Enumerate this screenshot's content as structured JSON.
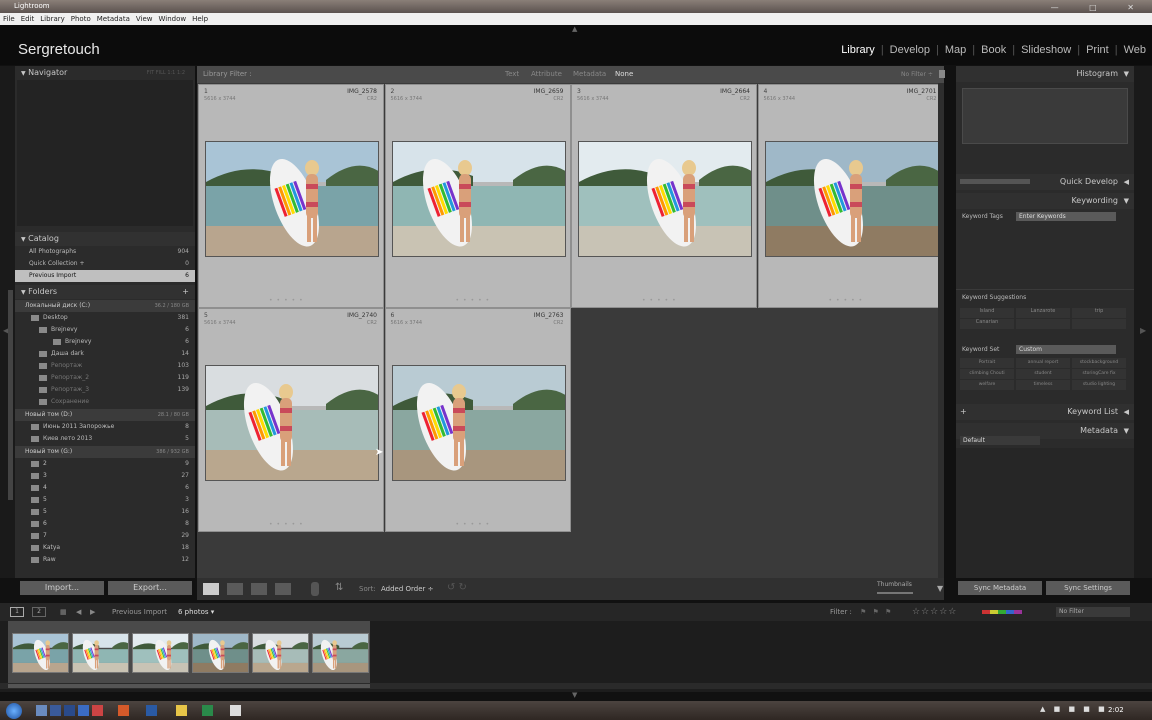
{
  "window": {
    "title": "Lightroom",
    "controls": "— □ ✕"
  },
  "menubar": [
    "File",
    "Edit",
    "Library",
    "Photo",
    "Metadata",
    "View",
    "Window",
    "Help"
  ],
  "header": {
    "identity": "Sergretouch",
    "modules": [
      "Library",
      "Develop",
      "Map",
      "Book",
      "Slideshow",
      "Print",
      "Web"
    ],
    "active_module": "Library"
  },
  "left_panel": {
    "navigator": {
      "title": "Navigator",
      "zoom": [
        "FIT",
        "FILL",
        "1:1",
        "1:2"
      ]
    },
    "catalog": {
      "title": "Catalog",
      "items": [
        {
          "label": "All Photographs",
          "count": "904"
        },
        {
          "label": "Quick Collection +",
          "count": "0"
        },
        {
          "label": "Previous Import",
          "count": "6"
        }
      ]
    },
    "folders": {
      "title": "Folders",
      "add": "+",
      "volumes": [
        {
          "name": "Локальный диск (C:)",
          "space": "36.2 / 180 GB",
          "items": [
            {
              "label": "Desktop",
              "count": "381"
            },
            {
              "label": "Brejnevy",
              "count": "6"
            },
            {
              "label": "Brejnevy",
              "count": "6"
            },
            {
              "label": "Даша dark",
              "count": "14"
            },
            {
              "label": "Репортаж",
              "count": "103"
            },
            {
              "label": "Репортаж_2",
              "count": "119"
            },
            {
              "label": "Репортаж_3",
              "count": "139"
            },
            {
              "label": "Сохранение",
              "count": ""
            }
          ]
        },
        {
          "name": "Новый том (D:)",
          "space": "28.1 / 80 GB",
          "items": [
            {
              "label": "Июнь 2011 Запорожье",
              "count": "8"
            },
            {
              "label": "Киев лето 2013",
              "count": "5"
            }
          ]
        },
        {
          "name": "Новый том (G:)",
          "space": "386 / 932 GB",
          "items": [
            {
              "label": "2",
              "count": "9"
            },
            {
              "label": "3",
              "count": "27"
            },
            {
              "label": "4",
              "count": "6"
            },
            {
              "label": "5",
              "count": "3"
            },
            {
              "label": "5",
              "count": "16"
            },
            {
              "label": "6",
              "count": "8"
            },
            {
              "label": "7",
              "count": "29"
            },
            {
              "label": "Katya",
              "count": "18"
            },
            {
              "label": "Raw",
              "count": "12"
            }
          ]
        }
      ]
    },
    "import_btn": "Import...",
    "export_btn": "Export..."
  },
  "filter_bar": {
    "label": "Library Filter :",
    "options": [
      "Text",
      "Attribute",
      "Metadata",
      "None"
    ],
    "active": "None",
    "preset": "No Filter ÷"
  },
  "grid": [
    {
      "index": "1",
      "filename": "IMG_2578",
      "dims": "5616 x 3744",
      "ext": "CR2"
    },
    {
      "index": "2",
      "filename": "IMG_2659",
      "dims": "5616 x 3744",
      "ext": "CR2"
    },
    {
      "index": "3",
      "filename": "IMG_2664",
      "dims": "5616 x 3744",
      "ext": "CR2"
    },
    {
      "index": "4",
      "filename": "IMG_2701",
      "dims": "5616 x 3744",
      "ext": "CR2"
    },
    {
      "index": "5",
      "filename": "IMG_2740",
      "dims": "5616 x 3744",
      "ext": "CR2"
    },
    {
      "index": "6",
      "filename": "IMG_2763",
      "dims": "5616 x 3744",
      "ext": "CR2"
    }
  ],
  "toolbar": {
    "sort_label": "Sort:",
    "sort_value": "Added Order ÷",
    "thumbnails_label": "Thumbnails"
  },
  "right_panel": {
    "histogram": "Histogram",
    "quick_develop": "Quick Develop",
    "keywording": "Keywording",
    "keyword_tags_label": "Keyword Tags",
    "keyword_tags_value": "Enter Keywords",
    "suggestions_label": "Keyword Suggestions",
    "suggestions": [
      "Island",
      "Lanzarote",
      "trip",
      "Canarian",
      "",
      ""
    ],
    "keyword_set_label": "Keyword Set",
    "keyword_set_value": "Custom",
    "keyword_set_items": [
      "Portrait",
      "annual report",
      "stockbackground",
      "climbing Chouti",
      "student",
      "storingCare fix",
      "welfare",
      "timeless",
      "studio lighting"
    ],
    "keyword_list": "Keyword List",
    "metadata": "Metadata",
    "metadata_preset": "Default",
    "sync_metadata": "Sync Metadata",
    "sync_settings": "Sync Settings"
  },
  "filmstrip_bar": {
    "pages": [
      "1",
      "2"
    ],
    "source": "Previous Import",
    "photo_count": "6 photos ▾",
    "filter_label": "Filter :",
    "filter_value": "No Filter"
  },
  "taskbar": {
    "time": "2:02"
  },
  "colors": {
    "accent": "#ffffff",
    "panel": "#2b2b2b",
    "grid_cell": "#b8b8b8",
    "header": "#0c0c0c"
  }
}
